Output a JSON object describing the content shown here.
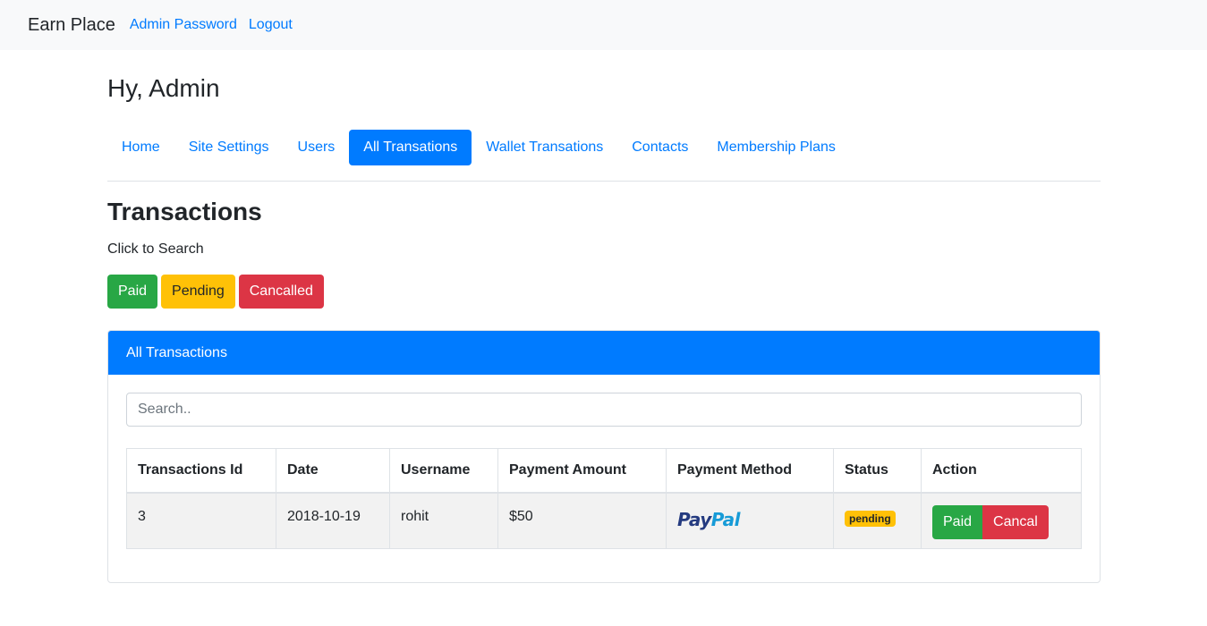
{
  "navbar": {
    "brand": "Earn Place",
    "links": [
      "Admin Password",
      "Logout"
    ]
  },
  "greeting": "Hy, Admin",
  "tabs": [
    {
      "label": "Home",
      "active": false
    },
    {
      "label": "Site Settings",
      "active": false
    },
    {
      "label": "Users",
      "active": false
    },
    {
      "label": "All Transations",
      "active": true
    },
    {
      "label": "Wallet Transations",
      "active": false
    },
    {
      "label": "Contacts",
      "active": false
    },
    {
      "label": "Membership Plans",
      "active": false
    }
  ],
  "section_title": "Transactions",
  "hint": "Click to Search",
  "filters": {
    "paid": "Paid",
    "pending": "Pending",
    "cancelled": "Cancalled"
  },
  "card": {
    "title": "All Transactions",
    "search_placeholder": "Search..",
    "table": {
      "headers": [
        "Transactions Id",
        "Date",
        "Username",
        "Payment Amount",
        "Payment Method",
        "Status",
        "Action"
      ],
      "rows": [
        {
          "id": "3",
          "date": "2018-10-19",
          "username": "rohit",
          "amount": "$50",
          "method": {
            "pay": "Pay",
            "pal": "Pal"
          },
          "status": "pending",
          "actions": {
            "paid": "Paid",
            "cancel": "Cancal"
          }
        }
      ]
    }
  },
  "colors": {
    "primary": "#007bff",
    "success": "#28a745",
    "warning": "#ffc107",
    "danger": "#dc3545"
  }
}
